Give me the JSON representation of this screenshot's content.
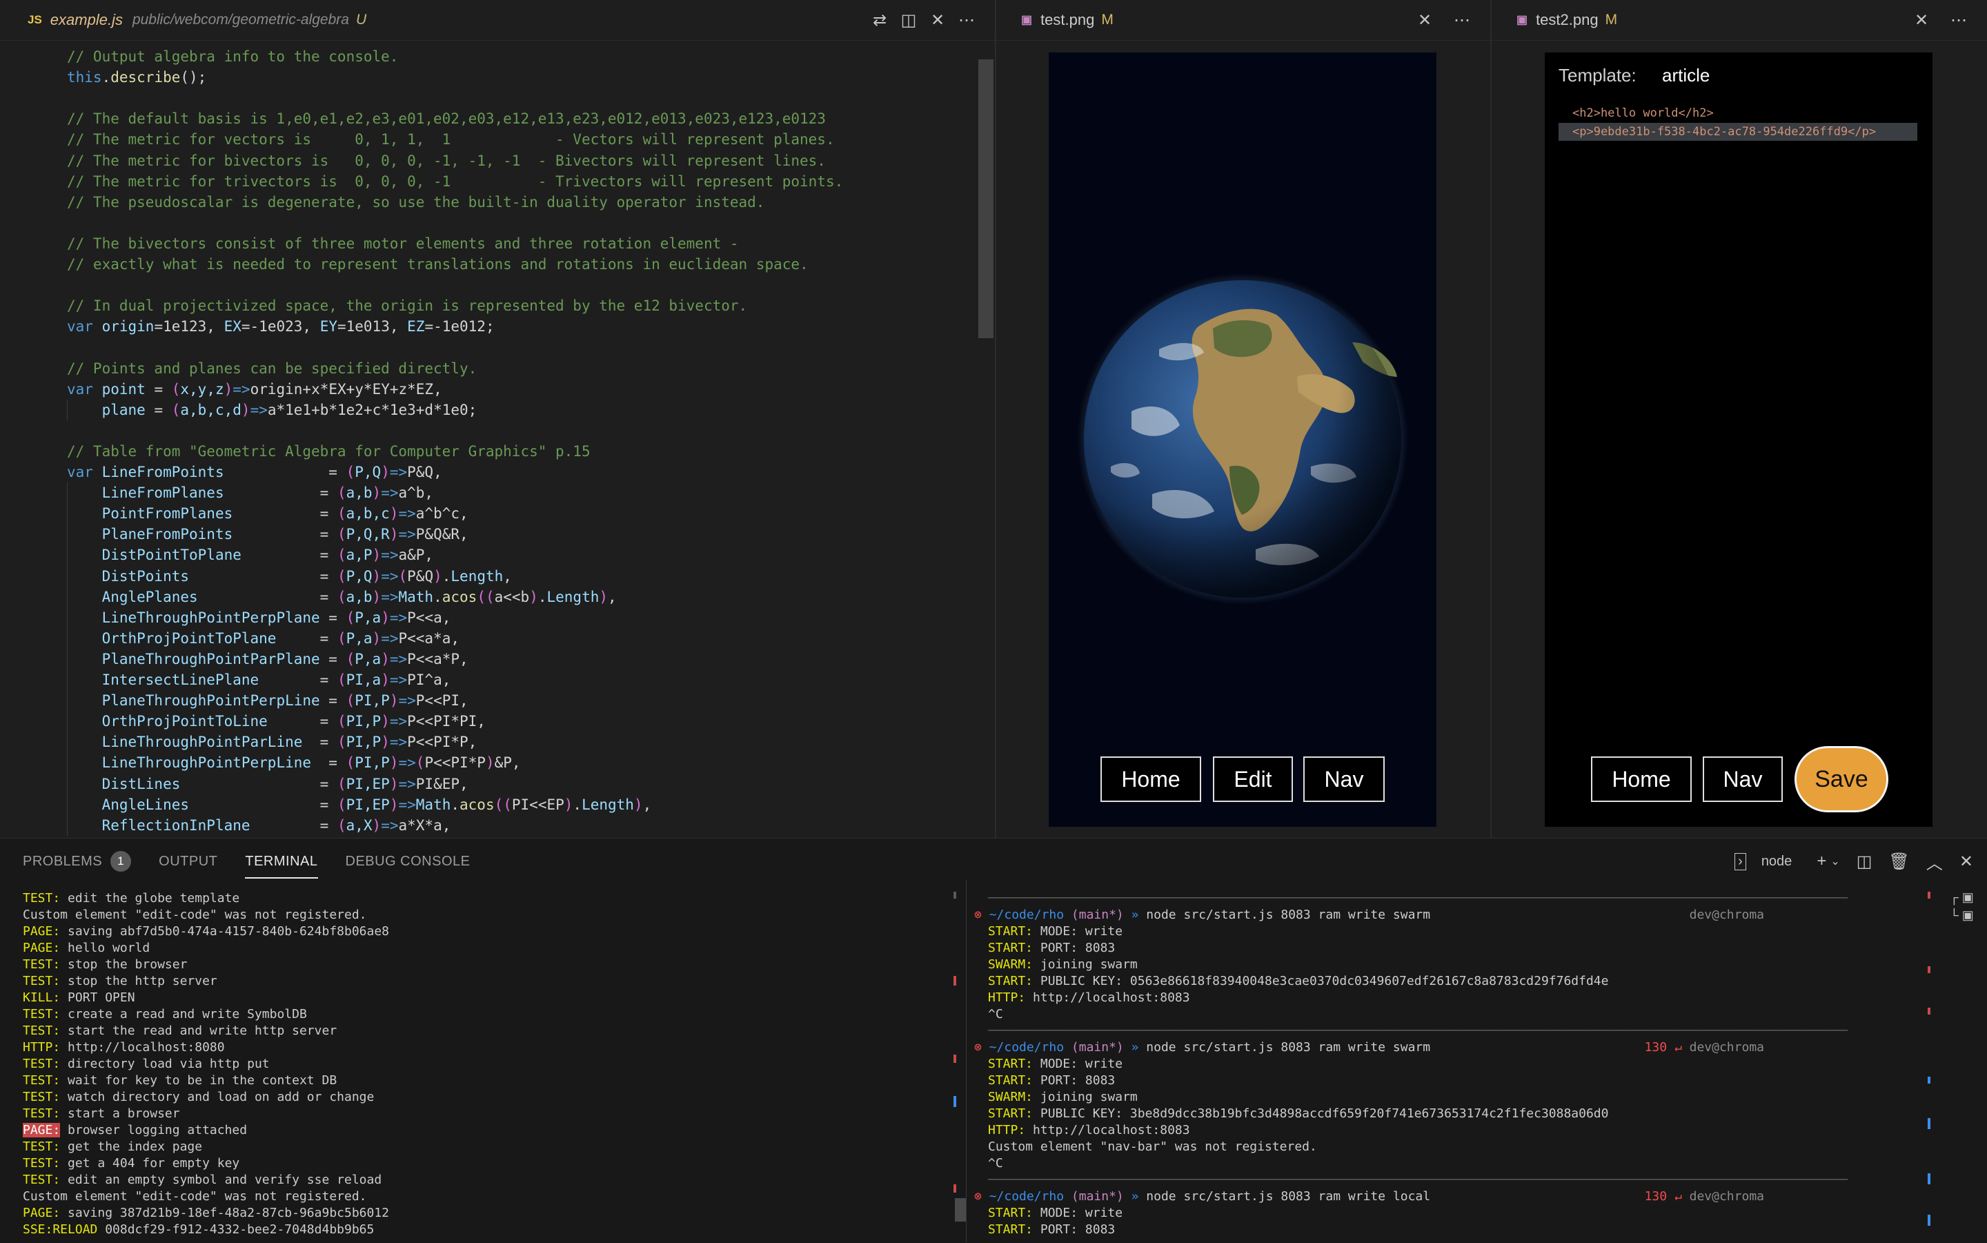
{
  "editor1": {
    "tab": {
      "icon": "JS",
      "filename": "example.js",
      "path": "public/webcom/geometric-algebra",
      "flag": "U"
    },
    "code": [
      [
        [
          "c-com",
          "// Output algebra info to the console."
        ]
      ],
      [
        [
          "c-kw",
          "this"
        ],
        [
          "c-def",
          "."
        ],
        [
          "c-fn",
          "describe"
        ],
        [
          "c-def",
          "();"
        ]
      ],
      [],
      [
        [
          "c-com",
          "// The default basis is 1,e0,e1,e2,e3,e01,e02,e03,e12,e13,e23,e012,e013,e023,e123,e0123"
        ]
      ],
      [
        [
          "c-com",
          "// The metric for vectors is     0, 1, 1,  1            - Vectors will represent planes."
        ]
      ],
      [
        [
          "c-com",
          "// The metric for bivectors is   0, 0, 0, -1, -1, -1  - Bivectors will represent lines."
        ]
      ],
      [
        [
          "c-com",
          "// The metric for trivectors is  0, 0, 0, -1          - Trivectors will represent points."
        ]
      ],
      [
        [
          "c-com",
          "// The pseudoscalar is degenerate, so use the built-in duality operator instead."
        ]
      ],
      [],
      [
        [
          "c-com",
          "// The bivectors consist of three motor elements and three rotation element -"
        ]
      ],
      [
        [
          "c-com",
          "// exactly what is needed to represent translations and rotations in euclidean space."
        ]
      ],
      [],
      [
        [
          "c-com",
          "// In dual projectivized space, the origin is represented by the e12 bivector."
        ]
      ],
      [
        [
          "c-kw",
          "var "
        ],
        [
          "c-var",
          "origin"
        ],
        [
          "c-def",
          "=1e123, "
        ],
        [
          "c-var",
          "EX"
        ],
        [
          "c-def",
          "=-1e023, "
        ],
        [
          "c-var",
          "EY"
        ],
        [
          "c-def",
          "=1e013, "
        ],
        [
          "c-var",
          "EZ"
        ],
        [
          "c-def",
          "=-1e012;"
        ]
      ],
      [],
      [
        [
          "c-com",
          "// Points and planes can be specified directly."
        ]
      ],
      [
        [
          "c-kw",
          "var "
        ],
        [
          "c-var",
          "point"
        ],
        [
          "c-def",
          " = "
        ],
        [
          "c-par",
          "("
        ],
        [
          "c-var",
          "x,y,z"
        ],
        [
          "c-par",
          ")"
        ],
        [
          "c-kw",
          "=>"
        ],
        [
          "c-def",
          "origin+x*EX+y*EY+z*EZ,"
        ]
      ],
      [
        [
          "c-def",
          "    "
        ],
        [
          "c-var",
          "plane"
        ],
        [
          "c-def",
          " = "
        ],
        [
          "c-par",
          "("
        ],
        [
          "c-var",
          "a,b,c,d"
        ],
        [
          "c-par",
          ")"
        ],
        [
          "c-kw",
          "=>"
        ],
        [
          "c-def",
          "a*1e1+b*1e2+c*1e3+d*1e0;"
        ]
      ],
      [],
      [
        [
          "c-com",
          "// Table from \"Geometric Algebra for Computer Graphics\" p.15"
        ]
      ],
      [
        [
          "c-kw",
          "var "
        ],
        [
          "c-var",
          "LineFromPoints           "
        ],
        [
          "c-def",
          " = "
        ],
        [
          "c-par",
          "("
        ],
        [
          "c-var",
          "P,Q"
        ],
        [
          "c-par",
          ")"
        ],
        [
          "c-kw",
          "=>"
        ],
        [
          "c-def",
          "P&Q,"
        ]
      ],
      [
        [
          "c-def",
          "    "
        ],
        [
          "c-var",
          "LineFromPlanes          "
        ],
        [
          "c-def",
          " = "
        ],
        [
          "c-par",
          "("
        ],
        [
          "c-var",
          "a,b"
        ],
        [
          "c-par",
          ")"
        ],
        [
          "c-kw",
          "=>"
        ],
        [
          "c-def",
          "a^b,"
        ]
      ],
      [
        [
          "c-def",
          "    "
        ],
        [
          "c-var",
          "PointFromPlanes         "
        ],
        [
          "c-def",
          " = "
        ],
        [
          "c-par",
          "("
        ],
        [
          "c-var",
          "a,b,c"
        ],
        [
          "c-par",
          ")"
        ],
        [
          "c-kw",
          "=>"
        ],
        [
          "c-def",
          "a^b^c,"
        ]
      ],
      [
        [
          "c-def",
          "    "
        ],
        [
          "c-var",
          "PlaneFromPoints         "
        ],
        [
          "c-def",
          " = "
        ],
        [
          "c-par",
          "("
        ],
        [
          "c-var",
          "P,Q,R"
        ],
        [
          "c-par",
          ")"
        ],
        [
          "c-kw",
          "=>"
        ],
        [
          "c-def",
          "P&Q&R,"
        ]
      ],
      [
        [
          "c-def",
          "    "
        ],
        [
          "c-var",
          "DistPointToPlane        "
        ],
        [
          "c-def",
          " = "
        ],
        [
          "c-par",
          "("
        ],
        [
          "c-var",
          "a,P"
        ],
        [
          "c-par",
          ")"
        ],
        [
          "c-kw",
          "=>"
        ],
        [
          "c-def",
          "a&P,"
        ]
      ],
      [
        [
          "c-def",
          "    "
        ],
        [
          "c-var",
          "DistPoints              "
        ],
        [
          "c-def",
          " = "
        ],
        [
          "c-par",
          "("
        ],
        [
          "c-var",
          "P,Q"
        ],
        [
          "c-par",
          ")"
        ],
        [
          "c-kw",
          "=>"
        ],
        [
          "c-par",
          "("
        ],
        [
          "c-def",
          "P&Q"
        ],
        [
          "c-par",
          ")"
        ],
        [
          "c-def",
          "."
        ],
        [
          "c-var",
          "Length"
        ],
        [
          "c-def",
          ","
        ]
      ],
      [
        [
          "c-def",
          "    "
        ],
        [
          "c-var",
          "AnglePlanes             "
        ],
        [
          "c-def",
          " = "
        ],
        [
          "c-par",
          "("
        ],
        [
          "c-var",
          "a,b"
        ],
        [
          "c-par",
          ")"
        ],
        [
          "c-kw",
          "=>"
        ],
        [
          "c-var",
          "Math"
        ],
        [
          "c-def",
          "."
        ],
        [
          "c-fn",
          "acos"
        ],
        [
          "c-par",
          "(("
        ],
        [
          "c-def",
          "a<<b"
        ],
        [
          "c-par",
          ")"
        ],
        [
          "c-def",
          "."
        ],
        [
          "c-var",
          "Length"
        ],
        [
          "c-par",
          ")"
        ],
        [
          "c-def",
          ","
        ]
      ],
      [
        [
          "c-def",
          "    "
        ],
        [
          "c-var",
          "LineThroughPointPerpPlane"
        ],
        [
          "c-def",
          " = "
        ],
        [
          "c-par",
          "("
        ],
        [
          "c-var",
          "P,a"
        ],
        [
          "c-par",
          ")"
        ],
        [
          "c-kw",
          "=>"
        ],
        [
          "c-def",
          "P<<a,"
        ]
      ],
      [
        [
          "c-def",
          "    "
        ],
        [
          "c-var",
          "OrthProjPointToPlane    "
        ],
        [
          "c-def",
          " = "
        ],
        [
          "c-par",
          "("
        ],
        [
          "c-var",
          "P,a"
        ],
        [
          "c-par",
          ")"
        ],
        [
          "c-kw",
          "=>"
        ],
        [
          "c-def",
          "P<<a*a,"
        ]
      ],
      [
        [
          "c-def",
          "    "
        ],
        [
          "c-var",
          "PlaneThroughPointParPlane"
        ],
        [
          "c-def",
          " = "
        ],
        [
          "c-par",
          "("
        ],
        [
          "c-var",
          "P,a"
        ],
        [
          "c-par",
          ")"
        ],
        [
          "c-kw",
          "=>"
        ],
        [
          "c-def",
          "P<<a*P,"
        ]
      ],
      [
        [
          "c-def",
          "    "
        ],
        [
          "c-var",
          "IntersectLinePlane      "
        ],
        [
          "c-def",
          " = "
        ],
        [
          "c-par",
          "("
        ],
        [
          "c-var",
          "PI,a"
        ],
        [
          "c-par",
          ")"
        ],
        [
          "c-kw",
          "=>"
        ],
        [
          "c-def",
          "PI^a,"
        ]
      ],
      [
        [
          "c-def",
          "    "
        ],
        [
          "c-var",
          "PlaneThroughPointPerpLine"
        ],
        [
          "c-def",
          " = "
        ],
        [
          "c-par",
          "("
        ],
        [
          "c-var",
          "PI,P"
        ],
        [
          "c-par",
          ")"
        ],
        [
          "c-kw",
          "=>"
        ],
        [
          "c-def",
          "P<<PI,"
        ]
      ],
      [
        [
          "c-def",
          "    "
        ],
        [
          "c-var",
          "OrthProjPointToLine     "
        ],
        [
          "c-def",
          " = "
        ],
        [
          "c-par",
          "("
        ],
        [
          "c-var",
          "PI,P"
        ],
        [
          "c-par",
          ")"
        ],
        [
          "c-kw",
          "=>"
        ],
        [
          "c-def",
          "P<<PI*PI,"
        ]
      ],
      [
        [
          "c-def",
          "    "
        ],
        [
          "c-var",
          "LineThroughPointParLine "
        ],
        [
          "c-def",
          " = "
        ],
        [
          "c-par",
          "("
        ],
        [
          "c-var",
          "PI,P"
        ],
        [
          "c-par",
          ")"
        ],
        [
          "c-kw",
          "=>"
        ],
        [
          "c-def",
          "P<<PI*P,"
        ]
      ],
      [
        [
          "c-def",
          "    "
        ],
        [
          "c-var",
          "LineThroughPointPerpLine"
        ],
        [
          "c-def",
          "  = "
        ],
        [
          "c-par",
          "("
        ],
        [
          "c-var",
          "PI,P"
        ],
        [
          "c-par",
          ")"
        ],
        [
          "c-kw",
          "=>"
        ],
        [
          "c-par",
          "("
        ],
        [
          "c-def",
          "P<<PI*P"
        ],
        [
          "c-par",
          ")"
        ],
        [
          "c-def",
          "&P,"
        ]
      ],
      [
        [
          "c-def",
          "    "
        ],
        [
          "c-var",
          "DistLines               "
        ],
        [
          "c-def",
          " = "
        ],
        [
          "c-par",
          "("
        ],
        [
          "c-var",
          "PI,EP"
        ],
        [
          "c-par",
          ")"
        ],
        [
          "c-kw",
          "=>"
        ],
        [
          "c-def",
          "PI&EP,"
        ]
      ],
      [
        [
          "c-def",
          "    "
        ],
        [
          "c-var",
          "AngleLines              "
        ],
        [
          "c-def",
          " = "
        ],
        [
          "c-par",
          "("
        ],
        [
          "c-var",
          "PI,EP"
        ],
        [
          "c-par",
          ")"
        ],
        [
          "c-kw",
          "=>"
        ],
        [
          "c-var",
          "Math"
        ],
        [
          "c-def",
          "."
        ],
        [
          "c-fn",
          "acos"
        ],
        [
          "c-par",
          "(("
        ],
        [
          "c-def",
          "PI<<EP"
        ],
        [
          "c-par",
          ")"
        ],
        [
          "c-def",
          "."
        ],
        [
          "c-var",
          "Length"
        ],
        [
          "c-par",
          ")"
        ],
        [
          "c-def",
          ","
        ]
      ],
      [
        [
          "c-def",
          "    "
        ],
        [
          "c-var",
          "ReflectionInPlane       "
        ],
        [
          "c-def",
          " = "
        ],
        [
          "c-par",
          "("
        ],
        [
          "c-var",
          "a,X"
        ],
        [
          "c-par",
          ")"
        ],
        [
          "c-kw",
          "=>"
        ],
        [
          "c-def",
          "a*X*a,"
        ]
      ]
    ]
  },
  "editor2": {
    "tab": {
      "filename": "test.png",
      "flag": "M"
    },
    "buttons": [
      "Home",
      "Edit",
      "Nav"
    ]
  },
  "editor3": {
    "tab": {
      "filename": "test2.png",
      "flag": "M"
    },
    "template_label": "Template:",
    "template_value": "article",
    "html_line1": "<h2>hello world</h2>",
    "html_line2": "<p>9ebde31b-f538-4bc2-ac78-954de226ffd9</p>",
    "buttons": [
      "Home",
      "Nav",
      "Save"
    ]
  },
  "panel": {
    "tabs": [
      "PROBLEMS",
      "OUTPUT",
      "TERMINAL",
      "DEBUG CONSOLE"
    ],
    "problems_count": "1",
    "shell_label": "node"
  },
  "terminal_left": [
    [
      [
        "k-test",
        "TEST:"
      ],
      [
        "",
        "edit the globe template"
      ]
    ],
    [
      [
        "",
        "Custom element \"edit-code\" was not registered."
      ]
    ],
    [
      [
        "k-page",
        "PAGE:"
      ],
      [
        "",
        "saving abf7d5b0-474a-4157-840b-624bf8b06ae8"
      ]
    ],
    [
      [
        "k-page",
        "PAGE:"
      ],
      [
        "",
        "hello world"
      ]
    ],
    [
      [
        "k-test",
        "TEST:"
      ],
      [
        "",
        "stop the browser"
      ]
    ],
    [
      [
        "k-test",
        "TEST:"
      ],
      [
        "",
        "stop the http server"
      ]
    ],
    [
      [
        "k-kill",
        "KILL:"
      ],
      [
        "",
        "PORT OPEN"
      ]
    ],
    [
      [
        "k-test",
        "TEST:"
      ],
      [
        "",
        "create a read and write SymbolDB"
      ]
    ],
    [
      [
        "k-test",
        "TEST:"
      ],
      [
        "",
        "start the read and write http server"
      ]
    ],
    [
      [
        "k-http",
        "HTTP:"
      ],
      [
        "",
        "http://localhost:8080"
      ]
    ],
    [
      [
        "k-test",
        "TEST:"
      ],
      [
        "",
        "directory load via http put"
      ]
    ],
    [
      [
        "k-test",
        "TEST:"
      ],
      [
        "",
        "wait for key to be in the context DB"
      ]
    ],
    [
      [
        "k-test",
        "TEST:"
      ],
      [
        "",
        "watch directory and load on add or change"
      ]
    ],
    [
      [
        "k-test",
        "TEST:"
      ],
      [
        "",
        "start a browser"
      ]
    ],
    [
      [
        "k-pagehl",
        "PAGE:"
      ],
      [
        "",
        "browser logging attached"
      ]
    ],
    [
      [
        "k-test",
        "TEST:"
      ],
      [
        "",
        "get the index page"
      ]
    ],
    [
      [
        "k-test",
        "TEST:"
      ],
      [
        "",
        "get a 404 for empty key"
      ]
    ],
    [
      [
        "k-test",
        "TEST:"
      ],
      [
        "",
        "edit an empty symbol and verify sse reload"
      ]
    ],
    [
      [
        "",
        "Custom element \"edit-code\" was not registered."
      ]
    ],
    [
      [
        "k-page",
        "PAGE:"
      ],
      [
        "",
        "saving 387d21b9-18ef-48a2-87cb-96a9bc5b6012"
      ]
    ],
    [
      [
        "k-sse",
        "SSE:RELOAD"
      ],
      [
        "",
        "008dcf29-f912-4332-bee2-7048d4bb9b65"
      ]
    ]
  ],
  "terminal_right": [
    {
      "type": "dash"
    },
    {
      "type": "prompt",
      "cmd": "node src/start.js 8083 ram write swarm",
      "code": "",
      "host": "dev@chroma"
    },
    {
      "type": "kv",
      "k": "START:",
      "v": "MODE: write"
    },
    {
      "type": "kv",
      "k": "START:",
      "v": "PORT: 8083"
    },
    {
      "type": "kv",
      "k": "SWARM:",
      "v": "joining swarm"
    },
    {
      "type": "kv",
      "k": "START:",
      "v": "PUBLIC KEY: 0563e86618f83940048e3cae0370dc0349607edf26167c8a8783cd29f76dfd4e"
    },
    {
      "type": "kv",
      "k": "HTTP:",
      "v": "http://localhost:8083"
    },
    {
      "type": "plain",
      "v": "^C"
    },
    {
      "type": "dash"
    },
    {
      "type": "prompt",
      "cmd": "node src/start.js 8083 ram write swarm",
      "code": "130 ↵",
      "host": "dev@chroma"
    },
    {
      "type": "kv",
      "k": "START:",
      "v": "MODE: write"
    },
    {
      "type": "kv",
      "k": "START:",
      "v": "PORT: 8083"
    },
    {
      "type": "kv",
      "k": "SWARM:",
      "v": "joining swarm"
    },
    {
      "type": "kv",
      "k": "START:",
      "v": "PUBLIC KEY: 3be8d9dcc38b19bfc3d4898accdf659f20f741e673653174c2f1fec3088a06d0"
    },
    {
      "type": "kv",
      "k": "HTTP:",
      "v": "http://localhost:8083"
    },
    {
      "type": "plain",
      "v": "Custom element \"nav-bar\" was not registered."
    },
    {
      "type": "plain",
      "v": "^C"
    },
    {
      "type": "dash"
    },
    {
      "type": "prompt",
      "cmd": "node src/start.js 8083 ram write local",
      "code": "130 ↵",
      "host": "dev@chroma"
    },
    {
      "type": "kv",
      "k": "START:",
      "v": "MODE: write"
    },
    {
      "type": "kv",
      "k": "START:",
      "v": "PORT: 8083"
    }
  ],
  "prompt_prefix": {
    "mark": "⊗",
    "path": "~/code/rho",
    "branch": "(main*)",
    "arrow": "»"
  }
}
